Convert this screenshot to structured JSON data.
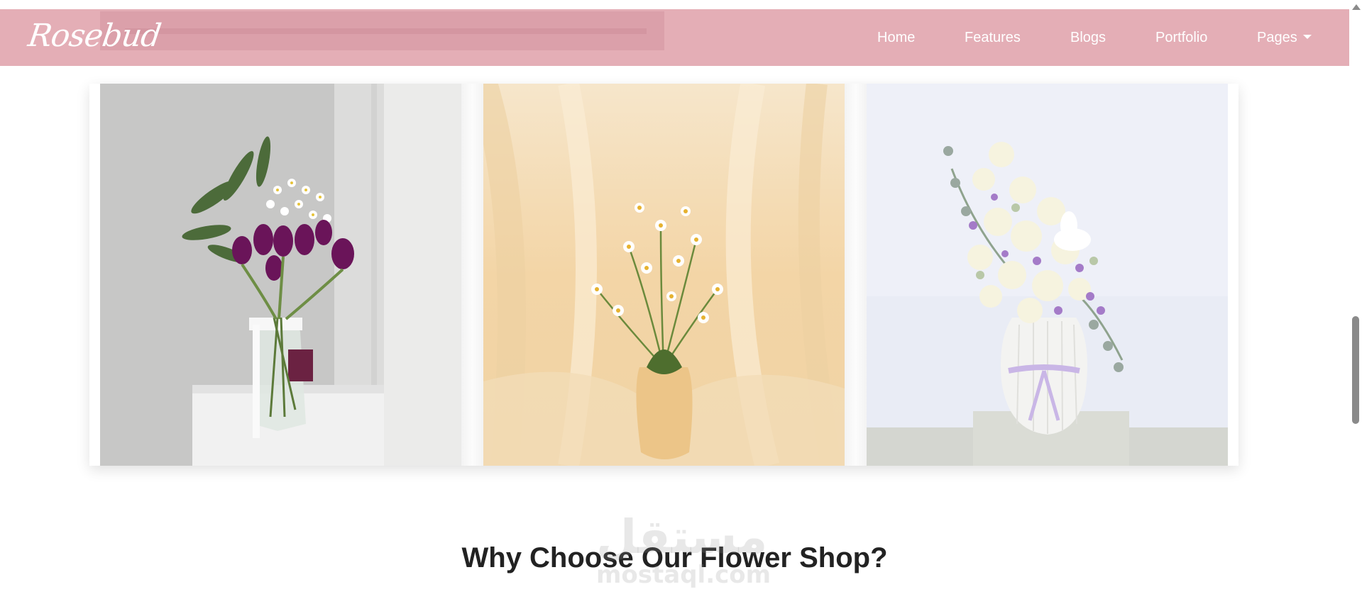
{
  "navbar": {
    "brand": "Rosebud",
    "items": [
      {
        "label": "Home"
      },
      {
        "label": "Features"
      },
      {
        "label": "Blogs"
      },
      {
        "label": "Portfolio"
      },
      {
        "label": "Pages"
      }
    ],
    "background": "#e4aeb6"
  },
  "gallery": {
    "images": [
      {
        "subject": "purple tulips with daisies in glass jar vase"
      },
      {
        "subject": "white daisies in cream vase against peach fabric"
      },
      {
        "subject": "white roses and lilac flowers in white ribbed vase"
      }
    ]
  },
  "section": {
    "title": "Why Choose Our Flower Shop?"
  },
  "watermark": {
    "arabic": "مستقل",
    "latin": "mostaql.com"
  }
}
